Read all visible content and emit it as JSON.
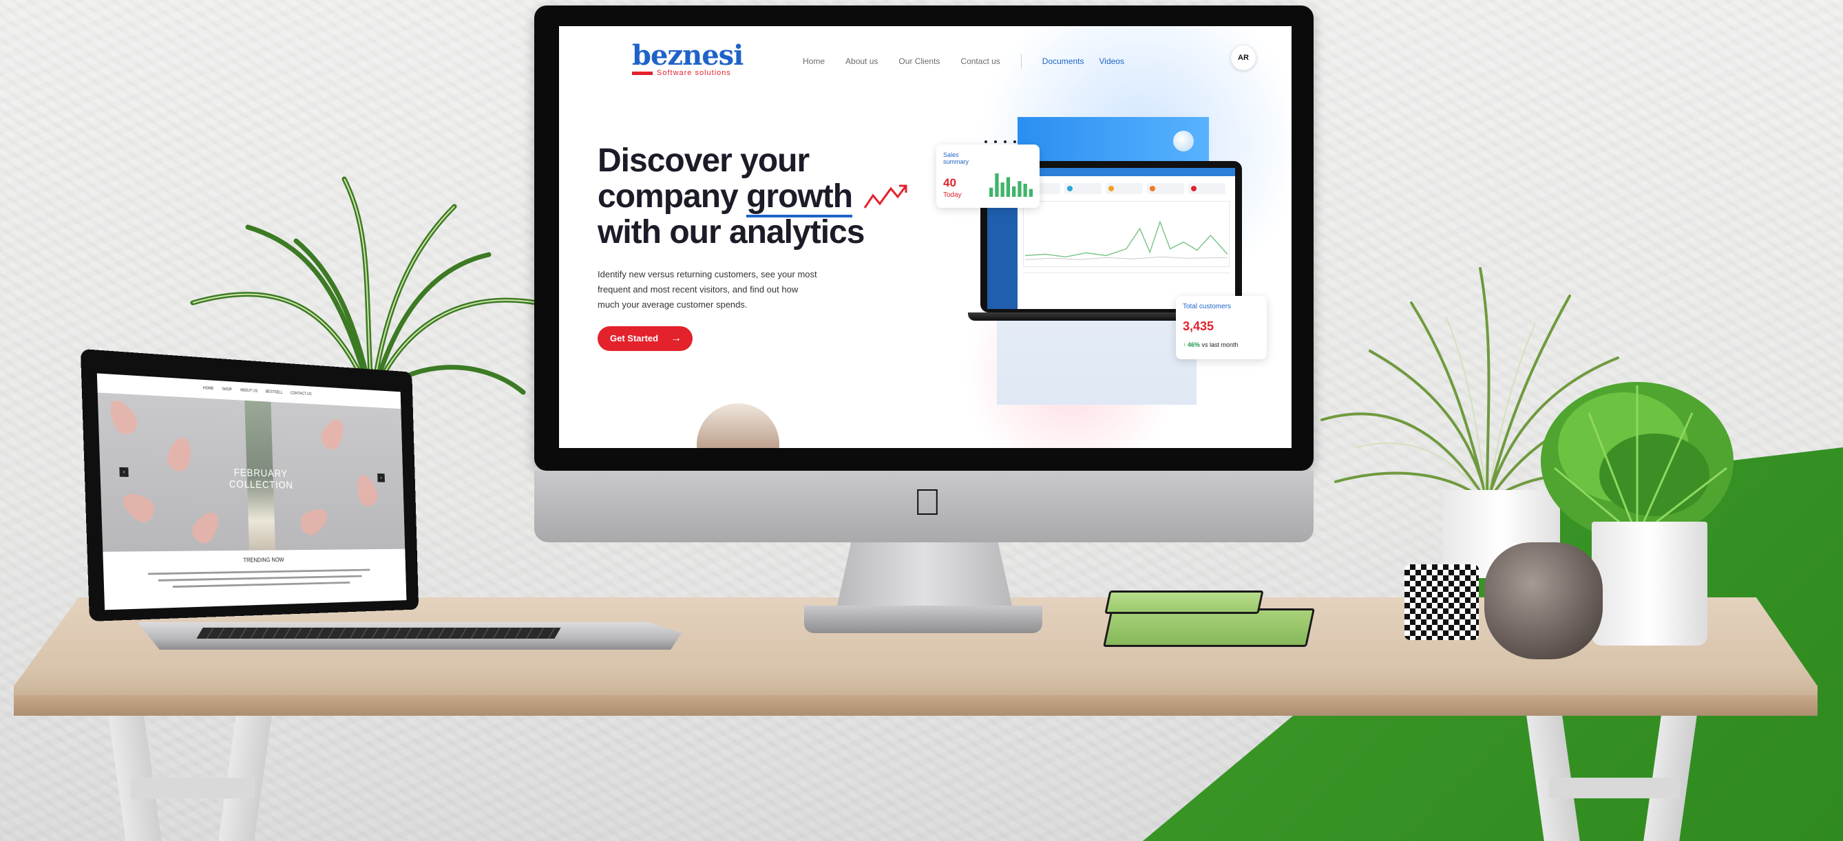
{
  "site": {
    "logo_word": "beznesi",
    "logo_tagline": "Software solutions",
    "nav": [
      "Home",
      "About us",
      "Our Clients",
      "Contact us"
    ],
    "nav_secondary": [
      "Documents",
      "Videos"
    ],
    "language": "AR",
    "hero": {
      "title_lines": [
        "Discover your",
        "company",
        "growth",
        "with our analytics"
      ],
      "description_lines": [
        "Identify new versus returning customers, see your most",
        "frequent and most recent visitors, and find out how",
        "much your average customer spends."
      ],
      "cta_label": "Get Started",
      "cta_icon": "arrow-right-icon"
    },
    "sales_card": {
      "title": "Sales summary",
      "value": "40",
      "sub": "Today",
      "bars": [
        0.35,
        0.9,
        0.55,
        0.75,
        0.4,
        0.6,
        0.5,
        0.3
      ]
    },
    "customers_card": {
      "title": "Total customers",
      "value": "3,435",
      "trend_value": "46%",
      "trend_text": "vs last month"
    }
  },
  "laptop_site": {
    "nav": [
      "HOME",
      "SHOP",
      "ABOUT US",
      "BESTSELL",
      "CONTACT US"
    ],
    "caption_lines": [
      "FEBRUARY",
      "COLLECTION"
    ],
    "section_heading": "TRENDING NOW"
  },
  "colors": {
    "brand_blue": "#1e63c8",
    "brand_red": "#e3222c",
    "floor_green": "#3f9a2a"
  }
}
